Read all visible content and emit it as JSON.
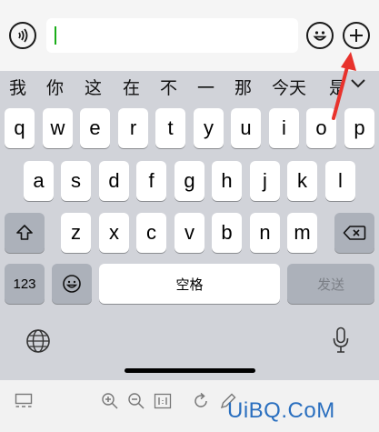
{
  "chat_input": {
    "value": ""
  },
  "candidates": [
    "我",
    "你",
    "这",
    "在",
    "不",
    "一",
    "那",
    "今天",
    "是"
  ],
  "keyboard": {
    "row1": [
      "q",
      "w",
      "e",
      "r",
      "t",
      "y",
      "u",
      "i",
      "o",
      "p"
    ],
    "row2": [
      "a",
      "s",
      "d",
      "f",
      "g",
      "h",
      "j",
      "k",
      "l"
    ],
    "row3": [
      "z",
      "x",
      "c",
      "v",
      "b",
      "n",
      "m"
    ],
    "numbers_label": "123",
    "space_label": "空格",
    "send_label": "发送"
  },
  "watermark": "UiBQ.CoM",
  "colors": {
    "arrow": "#e8322c",
    "caret": "#1aad19",
    "watermark": "#2a6fbf"
  }
}
